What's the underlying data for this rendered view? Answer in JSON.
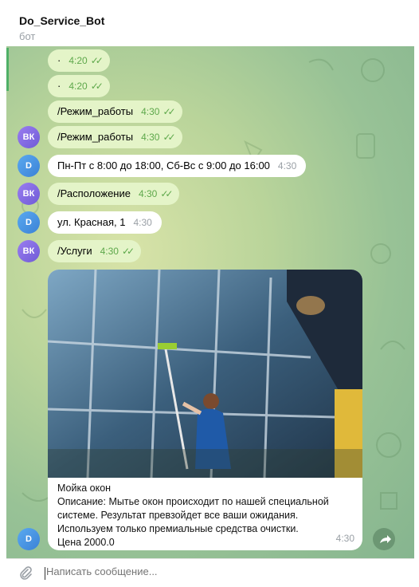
{
  "header": {
    "title": "Do_Service_Bot",
    "subtitle": "бот"
  },
  "messages": [
    {
      "text": "·",
      "time": "4:20",
      "checks": "✓✓"
    },
    {
      "text": "·",
      "time": "4:20",
      "checks": "✓✓"
    },
    {
      "text": "/Режим_работы",
      "time": "4:30",
      "checks": "✓✓"
    },
    {
      "avatar": "ВК",
      "text": "/Режим_работы",
      "time": "4:30",
      "checks": "✓✓"
    },
    {
      "avatar": "D",
      "text": "Пн-Пт с 8:00 до 18:00, Сб-Вс с 9:00 до 16:00",
      "time": "4:30"
    },
    {
      "avatar": "ВК",
      "text": "/Расположение",
      "time": "4:30",
      "checks": "✓✓"
    },
    {
      "avatar": "D",
      "text": "ул. Красная, 1",
      "time": "4:30"
    },
    {
      "avatar": "ВК",
      "text": "/Услуги",
      "time": "4:30",
      "checks": "✓✓"
    }
  ],
  "service_card": {
    "avatar": "D",
    "caption": "Мойка окон\nОписание: Мытье окон происходит по нашей специальной системе. Результат превзойдет все ваши ожидания.\nИспользуем только премиальные средства очистки.\nЦена 2000.0",
    "time": "4:30"
  },
  "composer": {
    "placeholder": "Написать сообщение..."
  },
  "colors": {
    "accent": "#5ea84b",
    "out_bubble": "#e4f4c8",
    "vk_avatar": "#7b64e0",
    "d_avatar": "#4a92e0"
  }
}
